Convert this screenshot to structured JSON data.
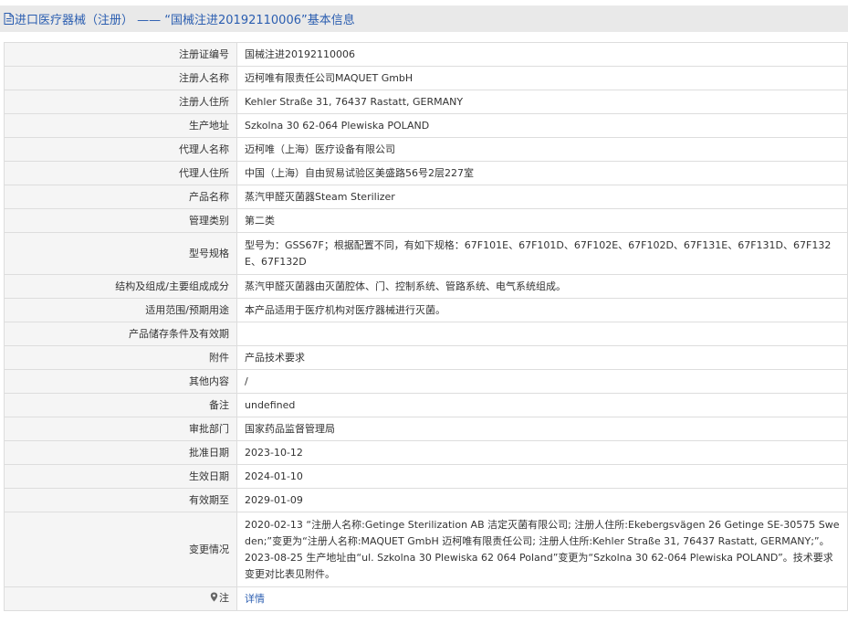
{
  "header": {
    "title": "进口医疗器械（注册） —— “国械注进20192110006”基本信息"
  },
  "rows": [
    {
      "label": "注册证编号",
      "value": "国械注进20192110006"
    },
    {
      "label": "注册人名称",
      "value": "迈柯唯有限责任公司MAQUET GmbH"
    },
    {
      "label": "注册人住所",
      "value": "Kehler Straße 31, 76437 Rastatt, GERMANY"
    },
    {
      "label": "生产地址",
      "value": "Szkolna 30 62-064 Plewiska POLAND"
    },
    {
      "label": "代理人名称",
      "value": "迈柯唯（上海）医疗设备有限公司"
    },
    {
      "label": "代理人住所",
      "value": "中国（上海）自由贸易试验区美盛路56号2层227室"
    },
    {
      "label": "产品名称",
      "value": "蒸汽甲醛灭菌器Steam Sterilizer"
    },
    {
      "label": "管理类别",
      "value": "第二类"
    },
    {
      "label": "型号规格",
      "value": "型号为：GSS67F；根据配置不同，有如下规格：67F101E、67F101D、67F102E、67F102D、67F131E、67F131D、67F132E、67F132D"
    },
    {
      "label": "结构及组成/主要组成成分",
      "value": "蒸汽甲醛灭菌器由灭菌腔体、门、控制系统、管路系统、电气系统组成。"
    },
    {
      "label": "适用范围/预期用途",
      "value": "本产品适用于医疗机构对医疗器械进行灭菌。"
    },
    {
      "label": "产品储存条件及有效期",
      "value": ""
    },
    {
      "label": "附件",
      "value": "产品技术要求"
    },
    {
      "label": "其他内容",
      "value": "/"
    },
    {
      "label": "备注",
      "value": "undefined"
    },
    {
      "label": "审批部门",
      "value": "国家药品监督管理局"
    },
    {
      "label": "批准日期",
      "value": "2023-10-12"
    },
    {
      "label": "生效日期",
      "value": "2024-01-10"
    },
    {
      "label": "有效期至",
      "value": "2029-01-09"
    }
  ],
  "changes": {
    "label": "变更情况",
    "line1": "2020-02-13 “注册人名称:Getinge Sterilization AB 洁定灭菌有限公司; 注册人住所:Ekebergsvägen 26 Getinge SE-30575 Sweden;”变更为“注册人名称:MAQUET GmbH 迈柯唯有限责任公司; 注册人住所:Kehler Straße 31, 76437 Rastatt, GERMANY;”。",
    "line2": "2023-08-25 生产地址由“ul. Szkolna 30 Plewiska 62 064 Poland”变更为“Szkolna 30 62-064 Plewiska POLAND”。技术要求变更对比表见附件。"
  },
  "note": {
    "label": "注",
    "icon": "map-pin-icon",
    "link_text": "详情"
  },
  "colors": {
    "title_text": "#2a5db0",
    "title_bg": "#e9e9e9",
    "label_bg": "#f5f5f5",
    "border": "#dddddd",
    "link": "#2a5db0"
  }
}
